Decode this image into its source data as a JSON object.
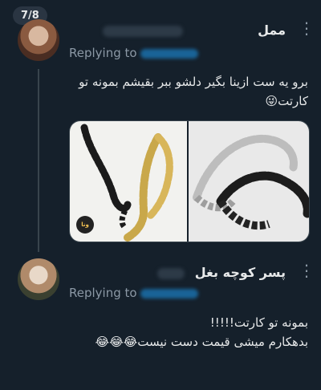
{
  "thread": {
    "position": "7/8"
  },
  "tweets": [
    {
      "author": "ممل",
      "replying_to": "Replying to",
      "text_lines": [
        "برو یه ست ازینا بگیر دلشو ببر بقیشم بمونه تو",
        "کارتت😜"
      ],
      "image_logo": "ونا"
    },
    {
      "author": "پسر کوچه بغل",
      "replying_to": "Replying to",
      "text_lines": [
        "بمونه تو کارتت!!!!!",
        "بدهکارم میشی قیمت دست نیست😂😂😂"
      ]
    }
  ],
  "colors": {
    "background": "#15202b",
    "text": "#e7e9ea",
    "muted": "#8b98a5",
    "link": "#1d9bf0"
  },
  "icons": [
    "more-options-icon",
    "thread-connector"
  ]
}
